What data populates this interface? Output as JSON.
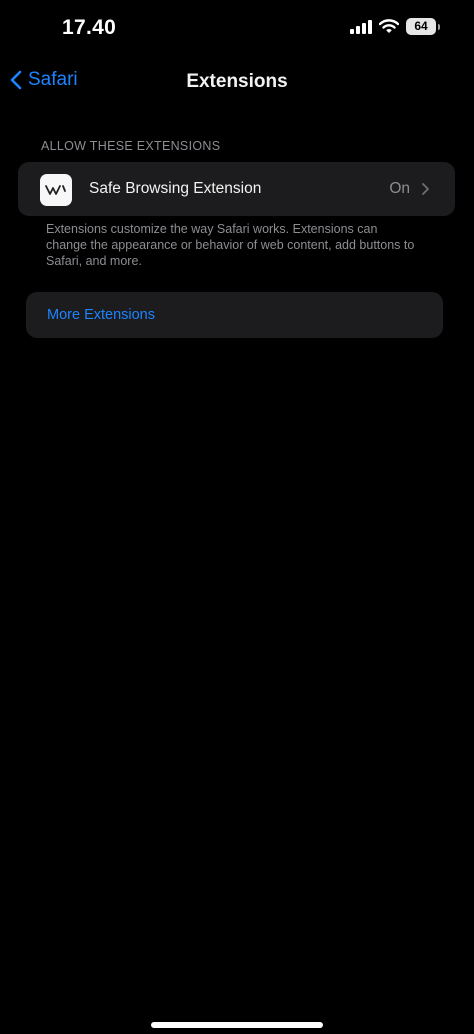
{
  "status_bar": {
    "time": "17.40",
    "battery_level": "64",
    "signal_icon": "cellular-signal-icon",
    "wifi_icon": "wifi-icon"
  },
  "nav": {
    "back_label": "Safari",
    "back_icon": "chevron-left-icon",
    "title": "Extensions"
  },
  "extensions_section": {
    "header": "ALLOW THESE EXTENSIONS",
    "items": [
      {
        "icon": "safe-browsing-app-icon",
        "label": "Safe Browsing Extension",
        "value": "On"
      }
    ],
    "footer": "Extensions customize the way Safari works. Extensions can change the appearance or behavior of web content, add buttons to Safari, and more."
  },
  "more_extensions": {
    "label": "More Extensions"
  },
  "colors": {
    "background": "#000000",
    "card": "#1c1c1e",
    "accent": "#1d84ff",
    "secondary_text": "#8d8d92"
  }
}
